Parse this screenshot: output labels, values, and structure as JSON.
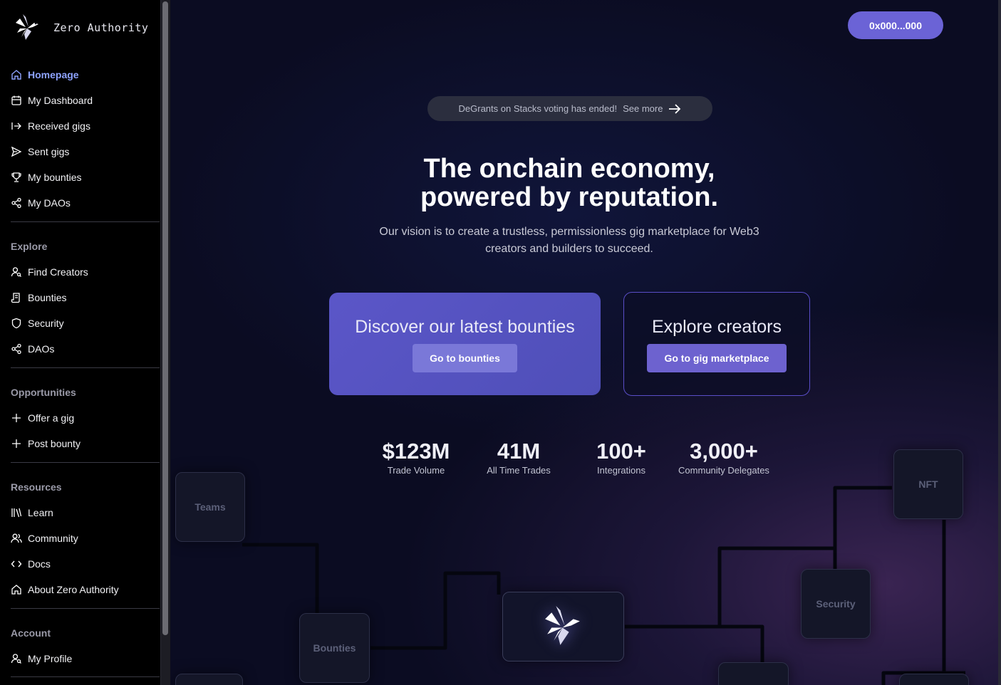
{
  "brand": {
    "name": "Zero Authority",
    "logo": "bird-logo-icon"
  },
  "sidebar": {
    "main_items": [
      {
        "label": "Homepage",
        "icon": "home-icon",
        "active": true
      },
      {
        "label": "My Dashboard",
        "icon": "calendar-icon"
      },
      {
        "label": "Received gigs",
        "icon": "arrow-right-to-line-icon"
      },
      {
        "label": "Sent gigs",
        "icon": "send-icon"
      },
      {
        "label": "My bounties",
        "icon": "trophy-icon"
      },
      {
        "label": "My DAOs",
        "icon": "share-nodes-icon"
      }
    ],
    "explore": {
      "title": "Explore",
      "items": [
        {
          "label": "Find Creators",
          "icon": "user-search-icon"
        },
        {
          "label": "Bounties",
          "icon": "scroll-icon"
        },
        {
          "label": "Security",
          "icon": "shield-icon"
        },
        {
          "label": "DAOs",
          "icon": "share-nodes-icon"
        }
      ]
    },
    "opportunities": {
      "title": "Opportunities",
      "items": [
        {
          "label": "Offer a gig",
          "icon": "plus-icon"
        },
        {
          "label": "Post bounty",
          "icon": "plus-icon"
        }
      ]
    },
    "resources": {
      "title": "Resources",
      "items": [
        {
          "label": "Learn",
          "icon": "library-icon"
        },
        {
          "label": "Community",
          "icon": "users-icon"
        },
        {
          "label": "Docs",
          "icon": "code-icon"
        },
        {
          "label": "About Zero Authority",
          "icon": "home-icon"
        }
      ]
    },
    "account": {
      "title": "Account",
      "items": [
        {
          "label": "My Profile",
          "icon": "user-search-icon"
        }
      ]
    }
  },
  "header": {
    "wallet_label": "0x000...000"
  },
  "announcement": {
    "text": "DeGrants on Stacks voting has ended!",
    "link": "See more"
  },
  "hero": {
    "title_line1": "The onchain economy,",
    "title_line2": "powered by reputation.",
    "subtitle_line1": "Our vision is to create a trustless, permissionless gig marketplace for Web3",
    "subtitle_line2": "creators and builders to succeed."
  },
  "cards": {
    "bounties": {
      "title": "Discover our latest bounties",
      "button": "Go to bounties"
    },
    "creators": {
      "title": "Explore creators",
      "button": "Go to gig marketplace"
    }
  },
  "stats": [
    {
      "value": "$123M",
      "label": "Trade Volume"
    },
    {
      "value": "41M",
      "label": "All Time Trades"
    },
    {
      "value": "100+",
      "label": "Integrations"
    },
    {
      "value": "3,000+",
      "label": "Community Delegates"
    }
  ],
  "diagram_nodes": {
    "teams": "Teams",
    "bounties": "Bounties",
    "nft": "NFT",
    "security": "Security"
  },
  "colors": {
    "accent": "#6b63d6",
    "active_nav": "#8ea3ff",
    "card_primary": "#5b56c8"
  }
}
